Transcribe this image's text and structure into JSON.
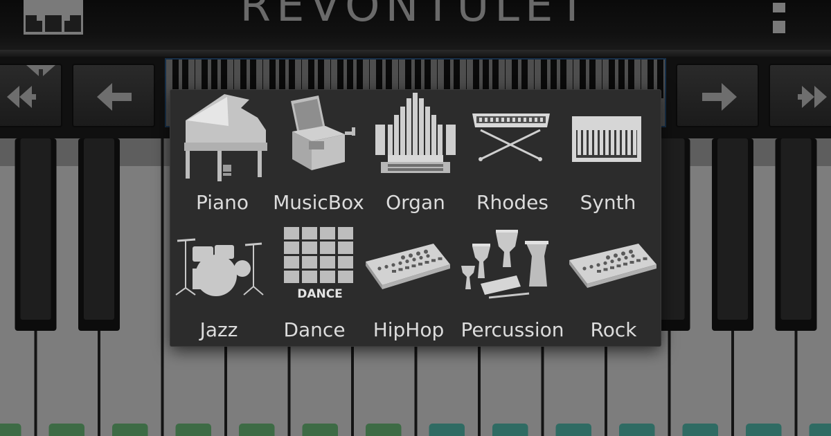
{
  "app": {
    "title": "REVONTULET"
  },
  "instruments": [
    {
      "label": "Piano",
      "icon": "grand-piano-icon"
    },
    {
      "label": "MusicBox",
      "icon": "music-box-icon"
    },
    {
      "label": "Organ",
      "icon": "pipe-organ-icon"
    },
    {
      "label": "Rhodes",
      "icon": "rhodes-keyboard-icon"
    },
    {
      "label": "Synth",
      "icon": "synth-keyboard-icon"
    },
    {
      "label": "Jazz",
      "icon": "drum-kit-icon"
    },
    {
      "label": "Dance",
      "icon": "dance-pad-icon",
      "badge": "DANCE"
    },
    {
      "label": "HipHop",
      "icon": "drum-machine-icon"
    },
    {
      "label": "Percussion",
      "icon": "percussion-icon"
    },
    {
      "label": "Rock",
      "icon": "groovebox-icon"
    }
  ],
  "icons": {
    "app": "piano-keys-icon",
    "menu": "overflow-menu-icon",
    "octave_down": "double-arrow-left-icon",
    "step_left": "arrow-left-icon",
    "step_right": "arrow-right-icon",
    "octave_up": "double-arrow-right-icon"
  },
  "colors": {
    "popup_bg": "#2c2c2c",
    "label": "#dcdcdc",
    "key_indicator_green": "#3d6b45",
    "key_indicator_teal": "#2f6b63",
    "keyboard_highlight": "#17304a"
  }
}
